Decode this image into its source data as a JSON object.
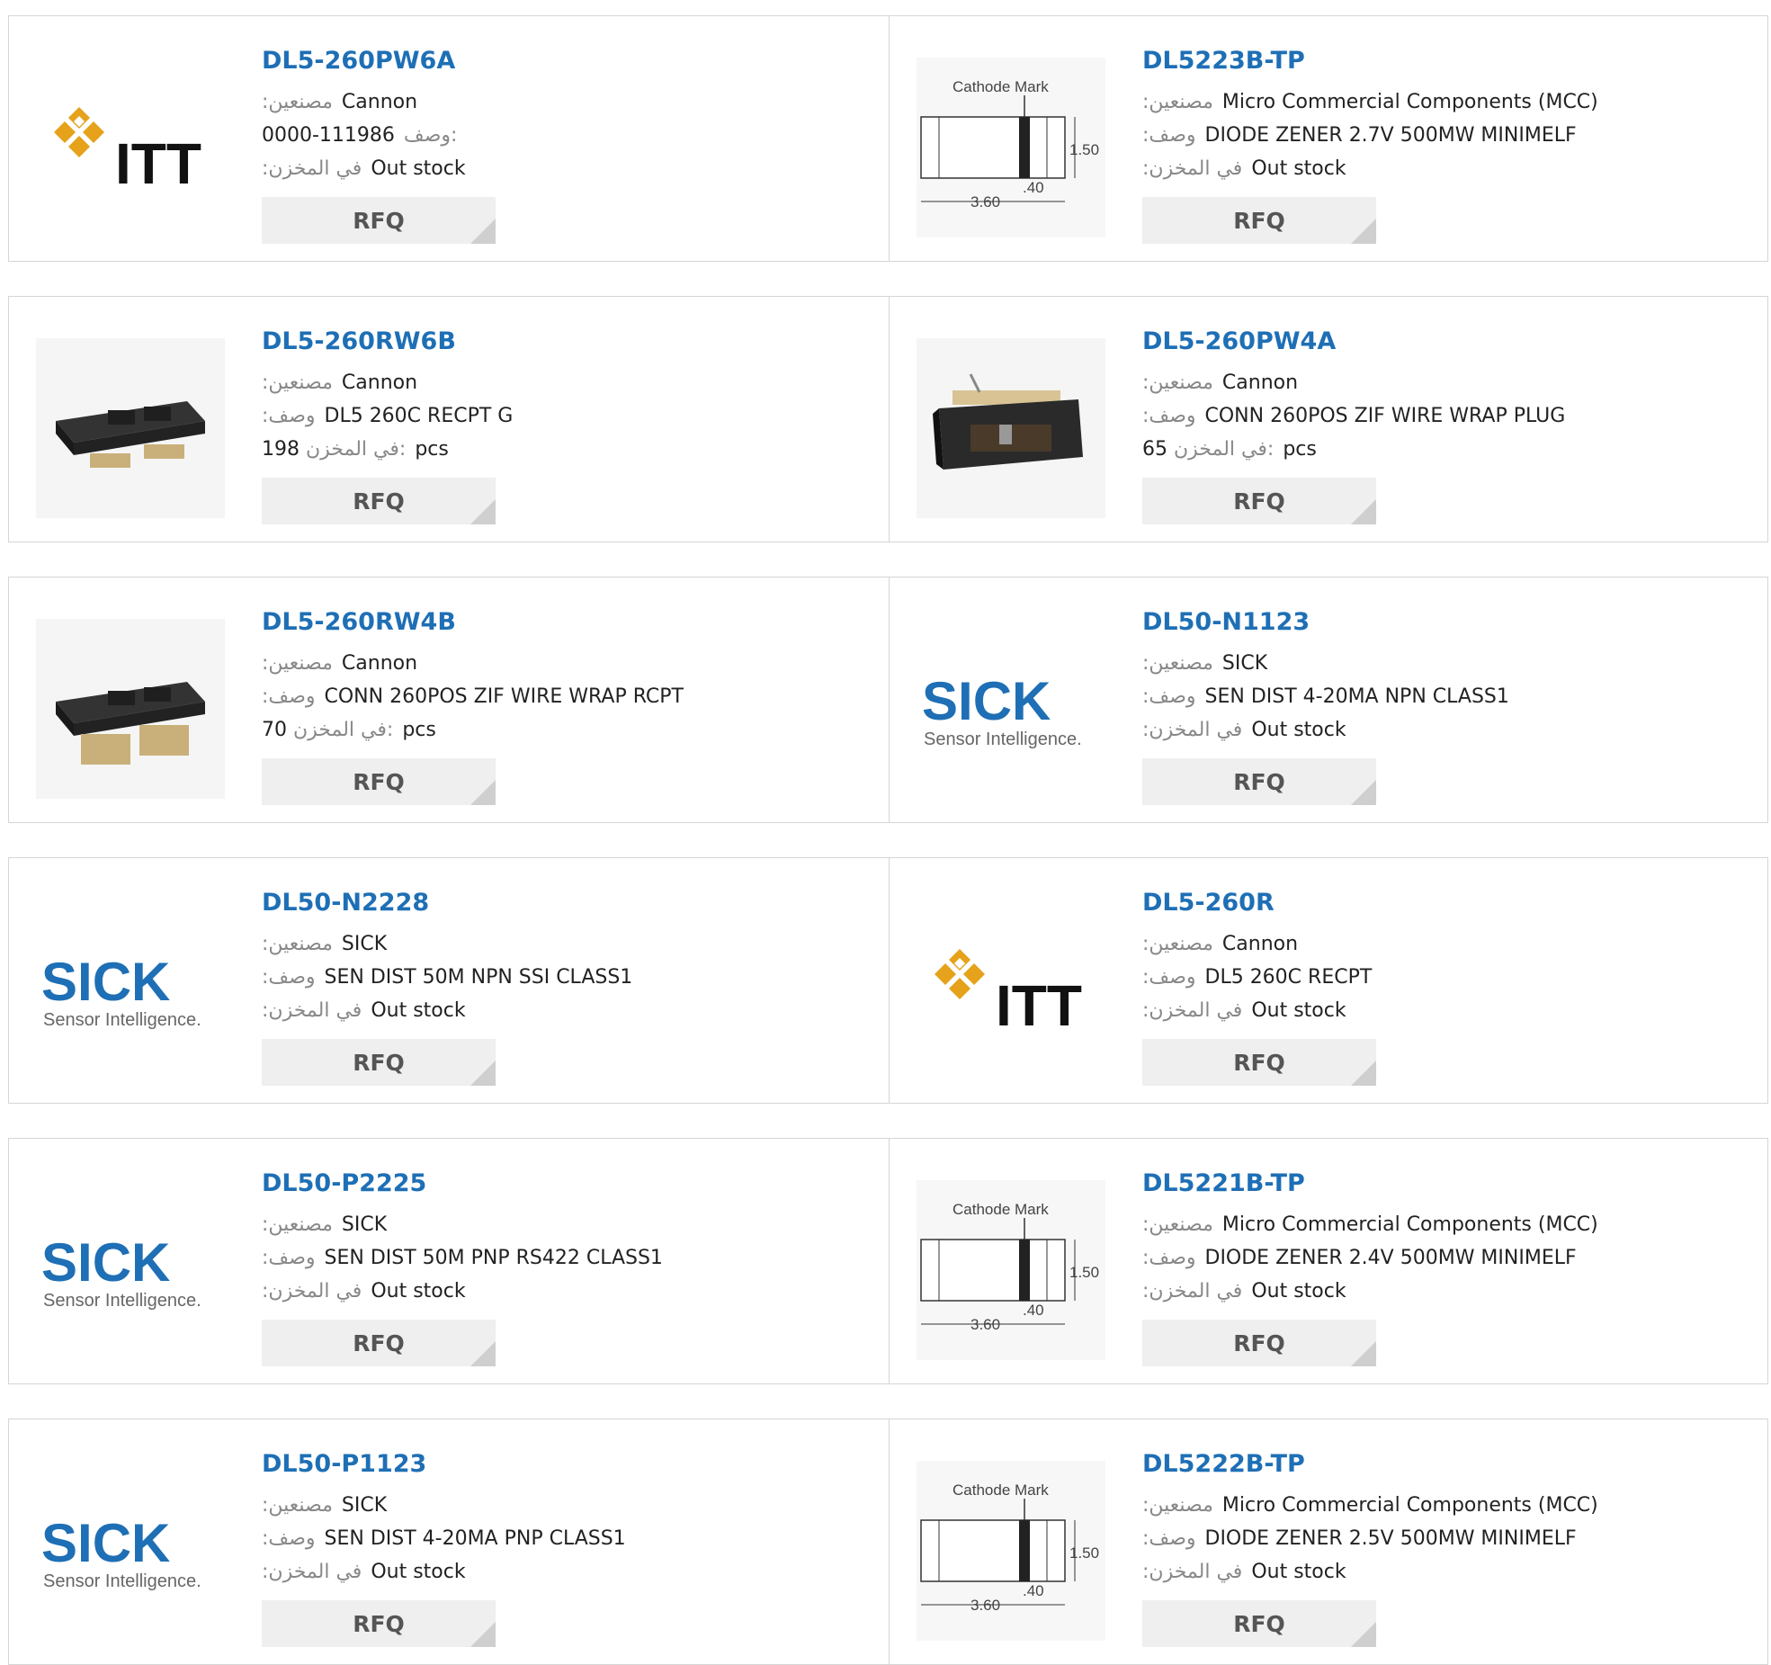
{
  "labels": {
    "manufacturer": ":مصنعين",
    "description": ":وصف",
    "description_first": "وصف:",
    "stock": ":في المخزن",
    "stock_qty": "في المخزن:",
    "pcs": "pcs",
    "out_stock": "Out stock",
    "rfq": "RFQ"
  },
  "logos": {
    "itt_text": "ITT",
    "sick_text": "SICK",
    "sick_tagline": "Sensor Intelligence.",
    "diode_mark": "Cathode Mark",
    "diode_height": "1.50",
    "diode_width": "3.60",
    "diode_band": ".40"
  },
  "colors": {
    "link": "#1e6fb5",
    "sick_blue": "#1e6fb5",
    "itt_gold": "#e5a21a"
  },
  "products": [
    {
      "part": "DL5-260PW6A",
      "manufacturer": "Cannon",
      "description": "0000-111986",
      "stock": "Out stock",
      "thumb": "itt-logo"
    },
    {
      "part": "DL5223B-TP",
      "manufacturer": "Micro Commercial Components (MCC)",
      "description": "DIODE ZENER 2.7V 500MW MINIMELF",
      "stock": "Out stock",
      "thumb": "diode-drawing"
    },
    {
      "part": "DL5-260RW6B",
      "manufacturer": "Cannon",
      "description": "DL5 260C RECPT G",
      "stock_qty": "198",
      "thumb": "connector-photo"
    },
    {
      "part": "DL5-260PW4A",
      "manufacturer": "Cannon",
      "description": "CONN 260POS ZIF WIRE WRAP PLUG",
      "stock_qty": "65",
      "thumb": "plug-photo"
    },
    {
      "part": "DL5-260RW4B",
      "manufacturer": "Cannon",
      "description": "CONN 260POS ZIF WIRE WRAP RCPT",
      "stock_qty": "70",
      "thumb": "connector-photo"
    },
    {
      "part": "DL50-N1123",
      "manufacturer": "SICK",
      "description": "SEN DIST 4-20MA NPN CLASS1",
      "stock": "Out stock",
      "thumb": "sick-logo"
    },
    {
      "part": "DL50-N2228",
      "manufacturer": "SICK",
      "description": "SEN DIST 50M NPN SSI CLASS1",
      "stock": "Out stock",
      "thumb": "sick-logo"
    },
    {
      "part": "DL5-260R",
      "manufacturer": "Cannon",
      "description": "DL5 260C RECPT",
      "stock": "Out stock",
      "thumb": "itt-logo"
    },
    {
      "part": "DL50-P2225",
      "manufacturer": "SICK",
      "description": "SEN DIST 50M PNP RS422 CLASS1",
      "stock": "Out stock",
      "thumb": "sick-logo"
    },
    {
      "part": "DL5221B-TP",
      "manufacturer": "Micro Commercial Components (MCC)",
      "description": "DIODE ZENER 2.4V 500MW MINIMELF",
      "stock": "Out stock",
      "thumb": "diode-drawing"
    },
    {
      "part": "DL50-P1123",
      "manufacturer": "SICK",
      "description": "SEN DIST 4-20MA PNP CLASS1",
      "stock": "Out stock",
      "thumb": "sick-logo"
    },
    {
      "part": "DL5222B-TP",
      "manufacturer": "Micro Commercial Components (MCC)",
      "description": "DIODE ZENER 2.5V 500MW MINIMELF",
      "stock": "Out stock",
      "thumb": "diode-drawing"
    }
  ]
}
